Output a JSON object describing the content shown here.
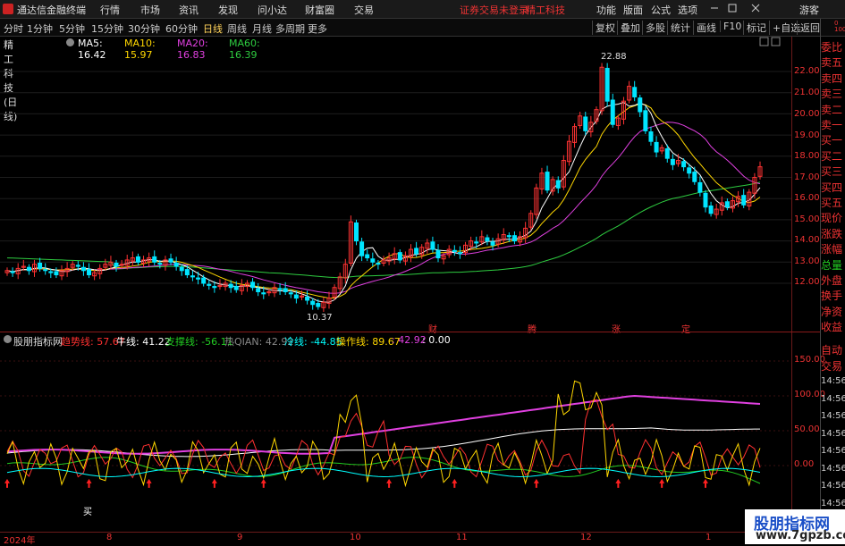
{
  "menubar": {
    "app_title": "通达信金融终端",
    "items": [
      "行情",
      "市场",
      "资讯",
      "发现",
      "问小达",
      "财富圈",
      "交易"
    ],
    "warning": "证券交易未登录",
    "stock_name": "精工科技",
    "right_items": [
      "功能",
      "版面",
      "公式",
      "选项"
    ],
    "guest": "游客"
  },
  "toolbar": {
    "periods": [
      "分时",
      "1分钟",
      "5分钟",
      "15分钟",
      "30分钟",
      "60分钟",
      "日线",
      "周线",
      "月线",
      "多周期",
      "更多"
    ],
    "active_period": "日线",
    "buttons": [
      "复权",
      "叠加",
      "多股",
      "统计",
      "画线",
      "F10",
      "标记",
      "+自选",
      "返回"
    ]
  },
  "main_chart": {
    "title": "精工科技(日线)",
    "ma5": "MA5: 16.42",
    "ma10": "MA10: 15.97",
    "ma20": "MA20: 16.83",
    "ma60": "MA60: 16.39",
    "high_label": "22.88",
    "low_label": "10.37",
    "y_ticks": [
      "22.00",
      "21.00",
      "20.00",
      "19.00",
      "18.00",
      "17.00",
      "16.00",
      "15.00",
      "14.00",
      "13.00",
      "12.00"
    ],
    "event_labels": [
      "财",
      "腾",
      "涨",
      "定"
    ],
    "colors": {
      "ma5": "#ffffff",
      "ma10": "#ffd700",
      "ma20": "#e040e0",
      "ma60": "#2ecc40",
      "up": "#ff3333",
      "down": "#00e5ff"
    }
  },
  "indicator": {
    "name": "股朋指标网",
    "items": [
      {
        "label": "趋势线: 57.67",
        "color": "#ff3030"
      },
      {
        "label": "牛线: 41.22",
        "color": "#ffffff"
      },
      {
        "label": "支撑线: -56.11",
        "color": "#22cc22"
      },
      {
        "label": "热QIAN: 42.92",
        "color": "#888888"
      },
      {
        "label": "冷线: -44.85",
        "color": "#00ffff"
      },
      {
        "label": "操作线: 89.67",
        "color": "#ffd700"
      },
      {
        "label": ": 42.92",
        "color": "#e040e0"
      },
      {
        "label": ": 0.00",
        "color": "#ffffff"
      }
    ],
    "y_ticks": [
      "150.00",
      "100.00",
      "50.00",
      "0.00"
    ],
    "buy_label": "买"
  },
  "right_panel": {
    "top_labels": [
      [
        "委比",
        "red"
      ],
      [
        "卖五",
        "red"
      ],
      [
        "卖四",
        "red"
      ],
      [
        "卖三",
        "red"
      ],
      [
        "卖二",
        "red"
      ],
      [
        "卖一",
        "red"
      ],
      [
        "买一",
        "red"
      ],
      [
        "买二",
        "red"
      ],
      [
        "买三",
        "red"
      ],
      [
        "买四",
        "red"
      ],
      [
        "买五",
        "red"
      ],
      [
        "现价",
        "red"
      ],
      [
        "涨跌",
        "red"
      ],
      [
        "涨幅",
        "red"
      ],
      [
        "总量",
        "green"
      ],
      [
        "外盘",
        "red"
      ],
      [
        "换手",
        "red"
      ],
      [
        "净资",
        "red"
      ],
      [
        "收益",
        "red"
      ]
    ],
    "extra_labels": [
      "自动",
      "交易"
    ],
    "times": [
      "14:56",
      "14:56",
      "14:56",
      "14:56",
      "14:56",
      "14:56",
      "14:56",
      "14:56"
    ],
    "top_marker": "0\n1000"
  },
  "x_axis": {
    "labels": [
      "2024年",
      "8",
      "9",
      "10",
      "11",
      "12",
      "1"
    ]
  },
  "watermark": {
    "title": "股朋指标网",
    "url": "www.7gpzb.com"
  }
}
